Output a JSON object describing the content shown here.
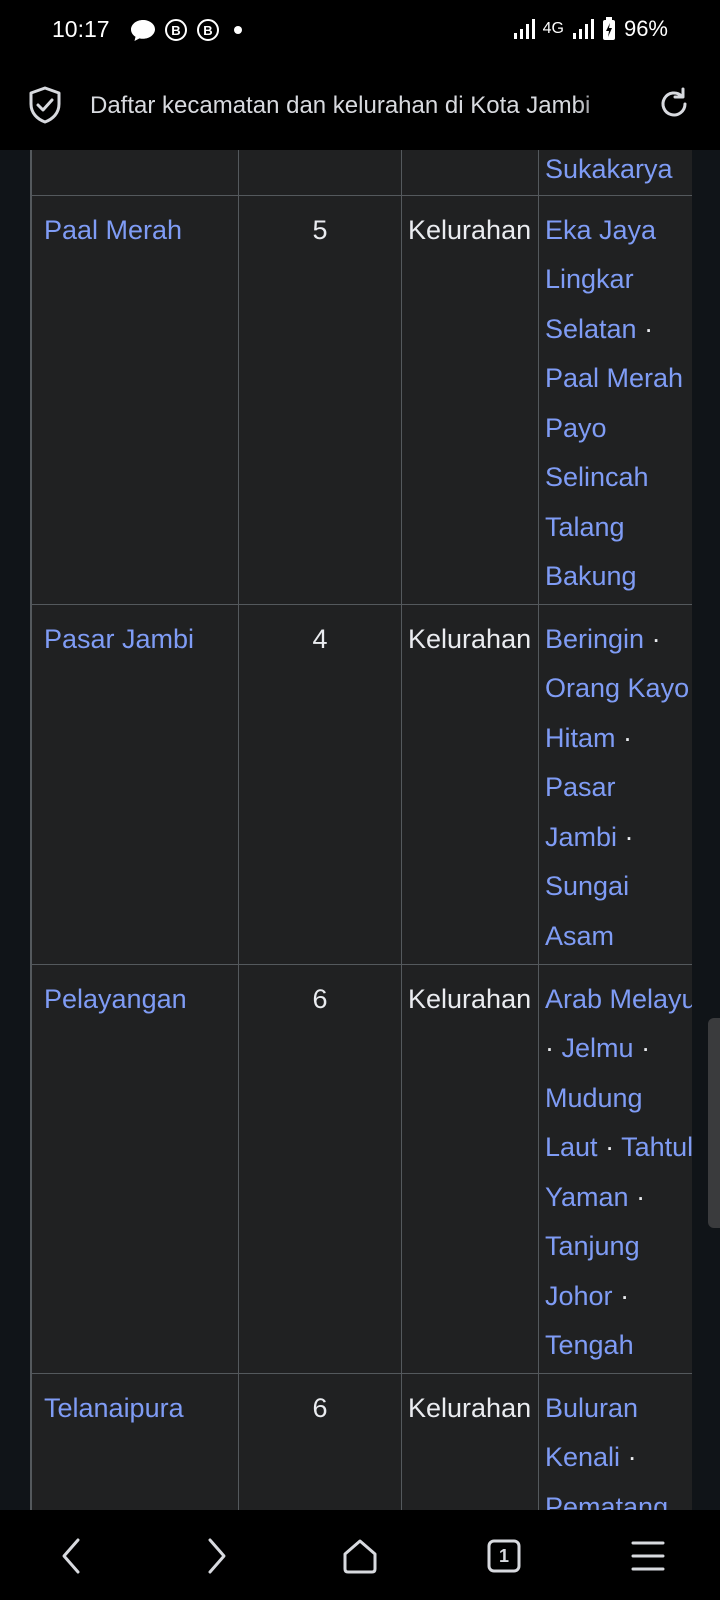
{
  "status_bar": {
    "time": "10:17",
    "network": "4G",
    "battery": "96%",
    "notification_icons": [
      "chat-bubble-icon",
      "b-circle-icon",
      "b-circle-icon",
      "dot-icon"
    ]
  },
  "address_bar": {
    "title": "Daftar kecamatan dan kelurahan di Kota Jambi"
  },
  "table": {
    "prev_row_tail": "Sukakarya",
    "rows": [
      {
        "name": "Paal Merah",
        "count": "5",
        "type": "Kelurahan",
        "villages_text": [
          "Eka Jaya",
          "Lingkar",
          "Selatan",
          "Paal Merah",
          "Payo",
          "Selincah",
          "Talang",
          "Bakung"
        ]
      },
      {
        "name": "Pasar Jambi",
        "count": "4",
        "type": "Kelurahan",
        "villages_text": [
          "Beringin",
          "Orang Kayo",
          "Hitam",
          "Pasar",
          "Jambi",
          "Sungai",
          "Asam"
        ]
      },
      {
        "name": "Pelayangan",
        "count": "6",
        "type": "Kelurahan",
        "villages_text": [
          "Arab Melayu",
          "Jelmu",
          "Mudung",
          "Laut",
          "Tahtul",
          "Yaman",
          "Tanjung",
          "Johor",
          "Tengah"
        ]
      },
      {
        "name": "Telanaipura",
        "count": "6",
        "type": "Kelurahan",
        "villages_text": [
          "Buluran",
          "Kenali",
          "Pematang"
        ]
      }
    ]
  },
  "nav_bar": {
    "tab_count": "1",
    "buttons": [
      "back-icon",
      "forward-icon",
      "home-icon",
      "tabs-icon",
      "menu-icon"
    ]
  },
  "colors": {
    "link": "#7f9cf5",
    "background": "#202122",
    "border": "#54595d"
  }
}
